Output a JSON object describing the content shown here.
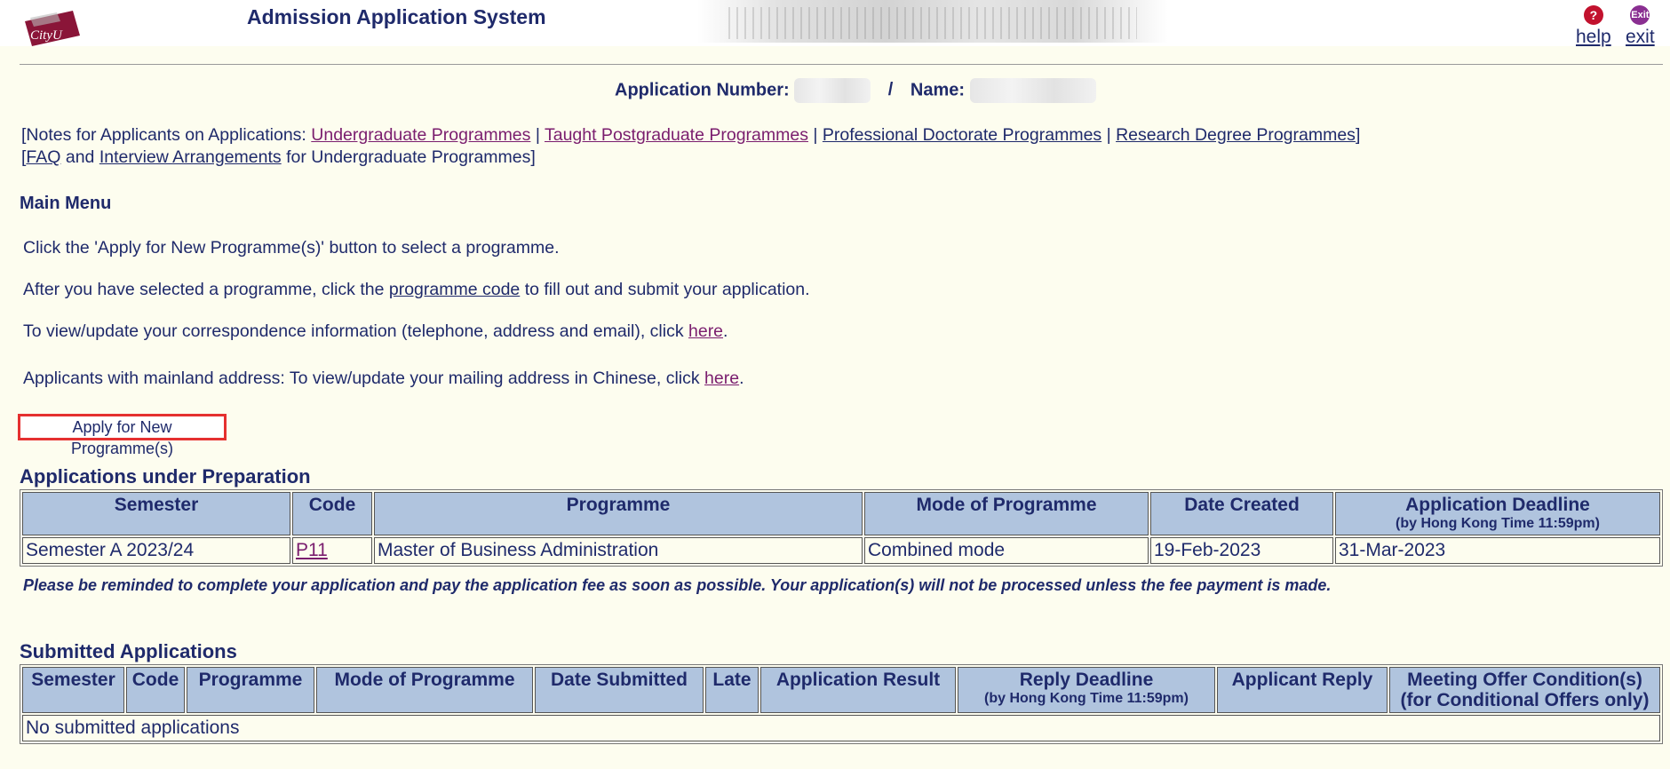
{
  "header": {
    "logo_text": "CityU",
    "title": "Admission Application System",
    "help_label": "help",
    "exit_label": "exit",
    "exit_icon_text": "Exit"
  },
  "applicant": {
    "number_label": "Application Number:",
    "separator": "/",
    "name_label": "Name:"
  },
  "notes": {
    "prefix": "[Notes for Applicants on Applications: ",
    "ug": "Undergraduate Programmes",
    "sep": " | ",
    "tpg": "Taught Postgraduate Programmes",
    "prof": "Professional Doctorate Programmes",
    "rd": "Research Degree Programmes",
    "suffix": "]",
    "line2_open": "[",
    "faq": "FAQ",
    "and": " and ",
    "interview": "Interview Arrangements",
    "line2_tail": " for Undergraduate Programmes]"
  },
  "main_menu": {
    "title": "Main Menu",
    "instr1": "Click the 'Apply for New Programme(s)' button to select a programme.",
    "instr2_pre": "After you have selected a programme, click the ",
    "instr2_link": "programme code",
    "instr2_post": " to fill out and submit your application.",
    "instr3_pre": "To view/update your correspondence information (telephone, address and email), click ",
    "instr3_link": "here",
    "instr3_post": ".",
    "instr4_pre": "Applicants with mainland address: To view/update your mailing address in Chinese, click ",
    "instr4_link": "here",
    "instr4_post": ".",
    "apply_button": "Apply for New Programme(s)"
  },
  "prep": {
    "heading": "Applications under Preparation",
    "headers": [
      "Semester",
      "Code",
      "Programme",
      "Mode of Programme",
      "Date Created",
      "Application Deadline"
    ],
    "deadline_sub": "(by Hong Kong Time 11:59pm)",
    "rows": [
      [
        "Semester A 2023/24",
        "P11",
        "Master of Business Administration",
        "Combined mode",
        "19-Feb-2023",
        "31-Mar-2023"
      ]
    ],
    "reminder": "Please be reminded to complete your application and pay the application fee as soon as possible. Your application(s) will not be processed unless the fee payment is made."
  },
  "submitted": {
    "heading": "Submitted Applications",
    "headers": [
      "Semester",
      "Code",
      "Programme",
      "Mode of Programme",
      "Date Submitted",
      "Late",
      "Application Result",
      "Reply Deadline",
      "Applicant Reply",
      "Meeting Offer Condition(s)"
    ],
    "reply_sub": "(by Hong Kong Time 11:59pm)",
    "offer_sub": "(for Conditional Offers only)",
    "empty": "No submitted applications"
  },
  "colors": {
    "text": "#1f2a6b",
    "link_visited": "#7a1d6e",
    "table_header": "#b0c4de",
    "background": "#fdfdef",
    "highlight": "#e53030"
  }
}
